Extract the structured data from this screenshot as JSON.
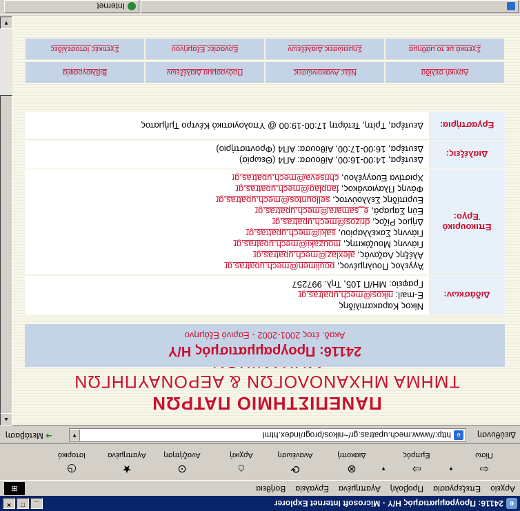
{
  "window": {
    "title": "24116: Προγραμματισμός Η/Υ - Microsoft Internet Explorer",
    "min": "_",
    "max": "□",
    "close": "×"
  },
  "menu": [
    "Αρχείο",
    "Επεξεργασία",
    "Προβολή",
    "Αγαπημένα",
    "Εργαλεία",
    "Βοήθεια"
  ],
  "toolbar": {
    "back": "Πίσω",
    "forward": "Εμπρός",
    "stop": "Διακοπή",
    "refresh": "Ανανέωση",
    "home": "Αρχική",
    "search": "Αναζήτηση",
    "favorites": "Αγαπημένα",
    "history": "Ιστορικό"
  },
  "address": {
    "label": "Διεύθυνση",
    "url": "http://www.mech.upatras.gr/~nikos/progr/index.html",
    "go": "Μετάβαση"
  },
  "page": {
    "university": "ΠΑΝΕΠΙΣΤΗΜΙΟ ΠΑΤΡΩΝ",
    "department": "ΤΜΗΜΑ ΜΗΧΑΝΟΛΟΓΩΝ & ΑΕΡΟΝΑΥΠΗΓΩΝ ΜΗΧΑΝΙΚΩΝ",
    "course_title": "24116: Προγραμματισμός Η/Υ",
    "course_term": "Ακαδ. έτος 2001-2002 - Εαρινό Εξάμηνο",
    "rows": {
      "instructor_label": "Διδάσκων:",
      "instructor_name": "Νίκος Καρακαπιλίδης",
      "instructor_email_prefix": "E-mail: ",
      "instructor_email": "nikos@mech.upatras.gr",
      "instructor_office": "Γραφείο: ΜΗ/Π 105, Τηλ. 997257",
      "assistants_label": "Επικουρικό Έργο:",
      "assistants": [
        {
          "name": "Άγγελος Πουλημένος, ",
          "email": "poulimen@mech.upatras.gr"
        },
        {
          "name": "Αλέξης Λαζανάς, ",
          "email": "alexlaz@mech.upatras.gr"
        },
        {
          "name": "Γιάννης Μουζάκιτης, ",
          "email": "mouzaki@mech.upatras.gr"
        },
        {
          "name": "Γιάννης Σακελλαρίου, ",
          "email": "saki@mech.upatras.gr"
        },
        {
          "name": "Δήμος Ρίζος, ",
          "email": "drizos@mech.upatras.gr"
        },
        {
          "name": "Εύη Σαμαρά, ",
          "email": "e_samara@mech.upatras.gr"
        },
        {
          "name": "Ευριπίδης Σελλούντος, ",
          "email": "sellountos@mech.upatras.gr"
        },
        {
          "name": "Φάνης Πλαγιανάκος, ",
          "email": "fanplag@mech.upatras.gr"
        },
        {
          "name": "Χριστίνα Ευαγγέλου, ",
          "email": "chriseva@mech.upatras.gr"
        }
      ],
      "lectures_label": "Διαλέξεις:",
      "lectures": [
        "Δευτέρα, 14:00-16:00, Αίθουσα: ΑΠ4 (Θεωρία)",
        "Δευτέρα, 16:00-17:00, Αίθουσα: ΑΠ4 (Φροντιστήριο)"
      ],
      "labs_label": "Εργαστήρια:",
      "labs": "Δευτέρα, Τρίτη, Τετάρτη 17:00-19:00 @ Υπολογιστικό Κέντρο Τμήματος"
    },
    "nav": [
      [
        "Αρχική σελίδα",
        "Νέες Ανακοινώσεις",
        "Πρόγραμμα Διαλέξεων",
        "Βιβλιογραφία"
      ],
      [
        "Σχετικά με το μάθημα",
        "Σημειώσεις Διαλέξεων",
        "Εργασίες Εξαμήνου",
        "Σχετικές Ιστοσελίδες"
      ]
    ]
  },
  "status": {
    "zone": "Internet"
  }
}
